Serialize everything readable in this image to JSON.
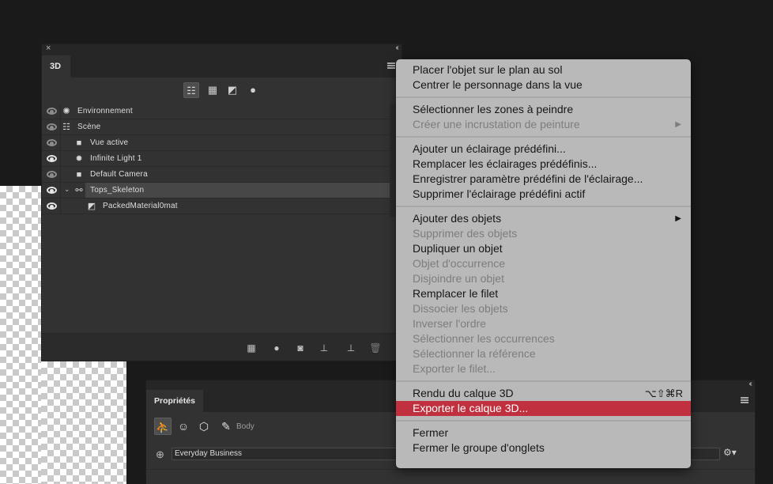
{
  "panel3d": {
    "tab_label": "3D",
    "tree_rows": [
      {
        "label": "Environnement",
        "icon": "environment-icon",
        "indent": 0,
        "bright_eye": false,
        "selected": false,
        "expander": false
      },
      {
        "label": "Scène",
        "icon": "scene-icon",
        "indent": 0,
        "bright_eye": false,
        "selected": false,
        "expander": false
      },
      {
        "label": "Vue active",
        "icon": "camera-icon",
        "indent": 1,
        "bright_eye": false,
        "selected": false,
        "expander": false
      },
      {
        "label": "Infinite Light 1",
        "icon": "light-icon",
        "indent": 1,
        "bright_eye": true,
        "selected": false,
        "expander": false
      },
      {
        "label": "Default Camera",
        "icon": "camera-icon",
        "indent": 1,
        "bright_eye": false,
        "selected": false,
        "expander": false
      },
      {
        "label": "Tops_Skeleton",
        "icon": "skeleton-icon",
        "indent": 1,
        "bright_eye": true,
        "selected": true,
        "expander": true
      },
      {
        "label": "PackedMaterial0mat",
        "icon": "material-icon",
        "indent": 2,
        "bright_eye": true,
        "selected": false,
        "expander": false
      }
    ]
  },
  "properties": {
    "tab_label": "Propriétés",
    "body_label": "Body",
    "preset_value": "Everyday Business"
  },
  "context_menu": {
    "groups": [
      [
        {
          "label": "Placer l'objet sur le plan au sol",
          "disabled": false
        },
        {
          "label": "Centrer le personnage dans la vue",
          "disabled": false
        }
      ],
      [
        {
          "label": "Sélectionner les zones à peindre",
          "disabled": false
        },
        {
          "label": "Créer une incrustation de peinture",
          "disabled": true,
          "submenu": true
        }
      ],
      [
        {
          "label": "Ajouter un éclairage prédéfini...",
          "disabled": false
        },
        {
          "label": "Remplacer les éclairages prédéfinis...",
          "disabled": false
        },
        {
          "label": "Enregistrer paramètre prédéfini de l'éclairage...",
          "disabled": false
        },
        {
          "label": "Supprimer l'éclairage prédéfini actif",
          "disabled": false
        }
      ],
      [
        {
          "label": "Ajouter des objets",
          "disabled": false,
          "submenu": true
        },
        {
          "label": "Supprimer des objets",
          "disabled": true
        },
        {
          "label": "Dupliquer un objet",
          "disabled": false
        },
        {
          "label": "Objet d'occurrence",
          "disabled": true
        },
        {
          "label": "Disjoindre un objet",
          "disabled": true
        },
        {
          "label": "Remplacer le filet",
          "disabled": false
        },
        {
          "label": "Dissocier les objets",
          "disabled": true
        },
        {
          "label": "Inverser l'ordre",
          "disabled": true
        },
        {
          "label": "Sélectionner les occurrences",
          "disabled": true
        },
        {
          "label": "Sélectionner la référence",
          "disabled": true
        },
        {
          "label": "Exporter le filet...",
          "disabled": true
        }
      ],
      [
        {
          "label": "Rendu du calque 3D",
          "disabled": false,
          "shortcut": "⌥⇧⌘R"
        },
        {
          "label": "Exporter le calque 3D...",
          "disabled": false,
          "highlighted": true
        }
      ],
      [
        {
          "label": "Fermer",
          "disabled": false
        },
        {
          "label": "Fermer le groupe d'onglets",
          "disabled": false
        }
      ]
    ]
  },
  "colors": {
    "highlight": "#c0303e",
    "menu_bg": "#b9b9b9",
    "panel_bg": "#323232"
  }
}
